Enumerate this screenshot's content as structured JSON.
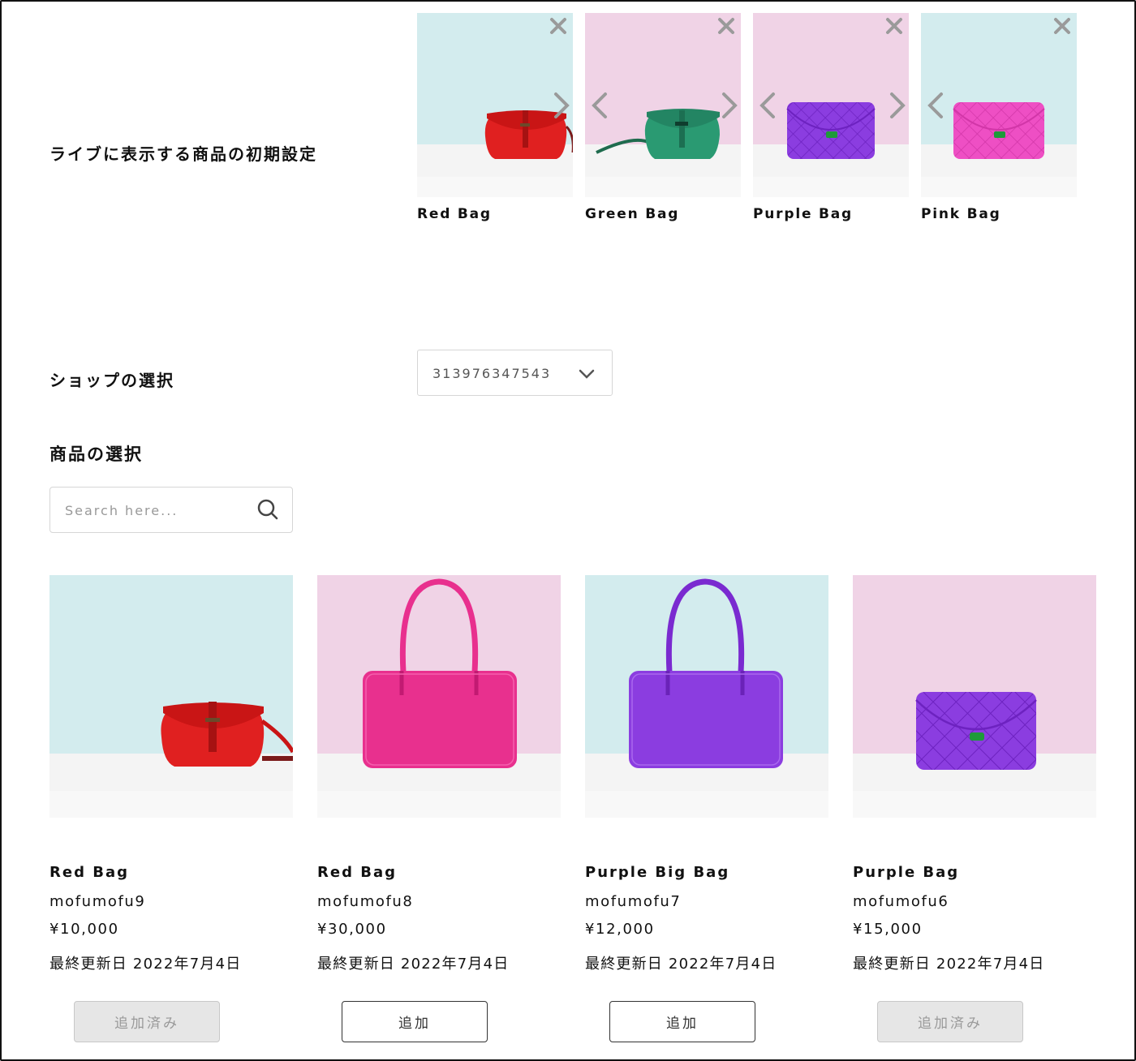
{
  "sections": {
    "initial_products_label": "ライブに表示する商品の初期設定",
    "shop_select_label": "ショップの選択",
    "product_select_label": "商品の選択"
  },
  "selected_products": [
    {
      "name": "Red Bag",
      "bg": "mint",
      "bag": "red-flap"
    },
    {
      "name": "Green Bag",
      "bg": "pink",
      "bag": "green-flap"
    },
    {
      "name": "Purple Bag",
      "bg": "pink",
      "bag": "purple-quilted"
    },
    {
      "name": "Pink Bag",
      "bg": "mint",
      "bag": "pink-quilted"
    }
  ],
  "shop_select": {
    "value": "313976347543"
  },
  "search": {
    "placeholder": "Search here..."
  },
  "products": [
    {
      "title": "Red Bag",
      "shop": "mofumofu9",
      "price": "¥10,000",
      "updated": "最終更新日 2022年7月4日",
      "button": "追加済み",
      "added": true
    },
    {
      "title": "Red Bag",
      "shop": "mofumofu8",
      "price": "¥30,000",
      "updated": "最終更新日 2022年7月4日",
      "button": "追加",
      "added": false
    },
    {
      "title": "Purple Big Bag",
      "shop": "mofumofu7",
      "price": "¥12,000",
      "updated": "最終更新日 2022年7月4日",
      "button": "追加",
      "added": false
    },
    {
      "title": "Purple Bag",
      "shop": "mofumofu6",
      "price": "¥15,000",
      "updated": "最終更新日 2022年7月4日",
      "button": "追加済み",
      "added": true
    }
  ],
  "colors": {
    "mint_bg": "#d3ecee",
    "pink_bg": "#f0d3e6",
    "floor": "#eeeeee",
    "red_bag": "#e02020",
    "green_bag": "#2a9a72",
    "purple_bag": "#8b3de0",
    "pink_bag": "#ee4fc4",
    "magenta_bag": "#e8308e"
  }
}
